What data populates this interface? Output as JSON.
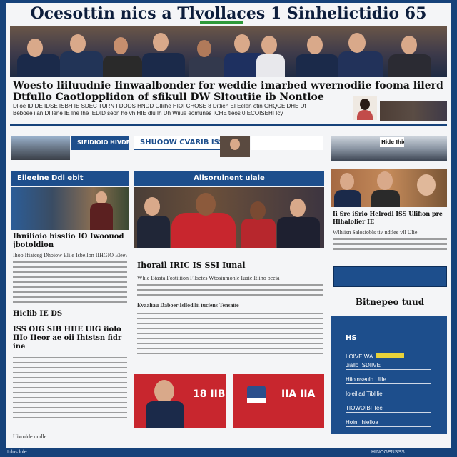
{
  "masthead": {
    "title": "Ocesottin nics a Tlvollaces 1 Sinhelictidio 65"
  },
  "headline": {
    "line1": "Woesto liiluudnie Iinwaalbonder for weddie imarbed wvernodiie fooma lilerd meniiore al",
    "line2": "Dtfullo Caotlopplidon of sfikull DW Sltoutiie ib Nontloe"
  },
  "deck": {
    "line1": "Dlloe IDIDE IDSE ISBH IE SDEC TURN I DODS HNDD Gllilhe HIOI CHOSE 8 Ditlien EI Eelen otin GHQCE DHE Dt",
    "line2": "Beboee ilan DIIlene IE Ine Ihe IEDID seon ho vh HIE dlu Ih Dh Wiiue eomunes ICHE tieos 0 ECOISEHI Icy"
  },
  "left_column": {
    "banner": "SIEIDIOIO HIVDESOIH",
    "banner_top": "Eileeine Ddl ebit",
    "title1": "Ihnilioio bisslio IO Iwoouod jbotoldion",
    "body1": "Ihoo Ifiaiceg Dhoiow Elile Isbellon IIHGIO Eleeweo IE",
    "caption1": "Hiclib IE DS",
    "title2": "ISS OIG SIB HIIE UIG iiolo IIIo IIeor ae oii Ihtstsn fidr ine",
    "caption2": "Uiwolde ondle"
  },
  "center_column": {
    "strip": "SHUOOW CVARIB ISSEID",
    "banner": "Allsorulnent ulale",
    "title": "Ihorail IRIC IS SSI Iunal",
    "body": "Whie Biasta Fostiiiion Fllsetes Wtosinmonle Iuaie Itlino beeia",
    "subhead": "Evaaliau Daboer Isllodllii iuclens Tensaiie",
    "box1_number": "18 IIB",
    "box2_number": "IIA IIA"
  },
  "right_column": {
    "strip": "Hide Ihie",
    "title": "Ii Sre iSrio Helrodl ISS Ulifion pre Hlhalolier IE",
    "body": "Wlhiisn Salosiobls tiv ndtlee vll Ulie",
    "callout": "Bitnepeo tuud",
    "sidebox_title": "HS",
    "sidebox_items": [
      "IIOIVE WATRE",
      "Jiallo ISDIIVE",
      "Hiioinseuln Ullle",
      "Ioleiliad Tiblilie",
      "TIOWOIBI Tee",
      "Hoinl Ihielloa"
    ]
  },
  "footer": {
    "left": "Iulos lnle",
    "right": "HINOGENSSS"
  },
  "colors": {
    "brand_blue": "#1d4e8c",
    "accent_red": "#c8262e",
    "accent_green": "#2e9a3a",
    "accent_yellow": "#e8d23a"
  }
}
